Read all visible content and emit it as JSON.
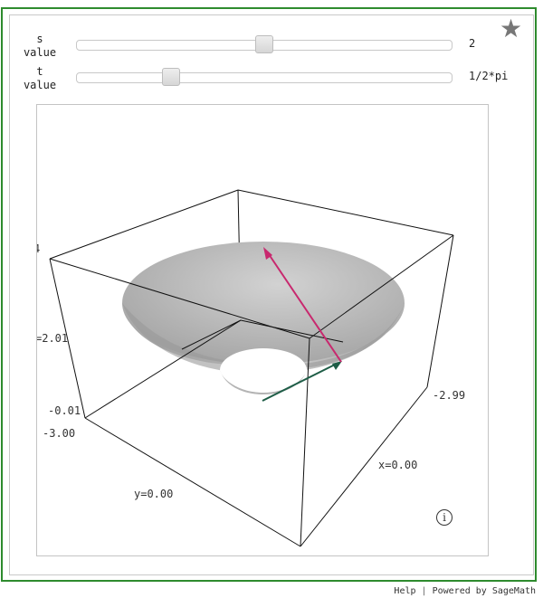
{
  "sliders": [
    {
      "label": "s\nvalue",
      "value": "2",
      "position_fraction": 0.5
    },
    {
      "label": "t\nvalue",
      "value": "1/2*pi",
      "position_fraction": 0.25
    }
  ],
  "plot": {
    "axis_labels": {
      "z_top": "4",
      "z_mid": "=2.01",
      "z_low": "-0.01",
      "y_min": "-3.00",
      "y_axis": "y=0.00",
      "x_axis": "x=0.00",
      "x_max": "-2.99"
    },
    "colors": {
      "frame": "#111111",
      "surface_light": "#d8d8d8",
      "surface_dark": "#8e8e8e",
      "vector_normal": "#c8286e",
      "vector_tangent": "#1d5c46"
    }
  },
  "icons": {
    "favorite": "star-icon",
    "info": "info-icon"
  },
  "footer": {
    "help": "Help",
    "separator": "|",
    "powered": "Powered by SageMath"
  }
}
